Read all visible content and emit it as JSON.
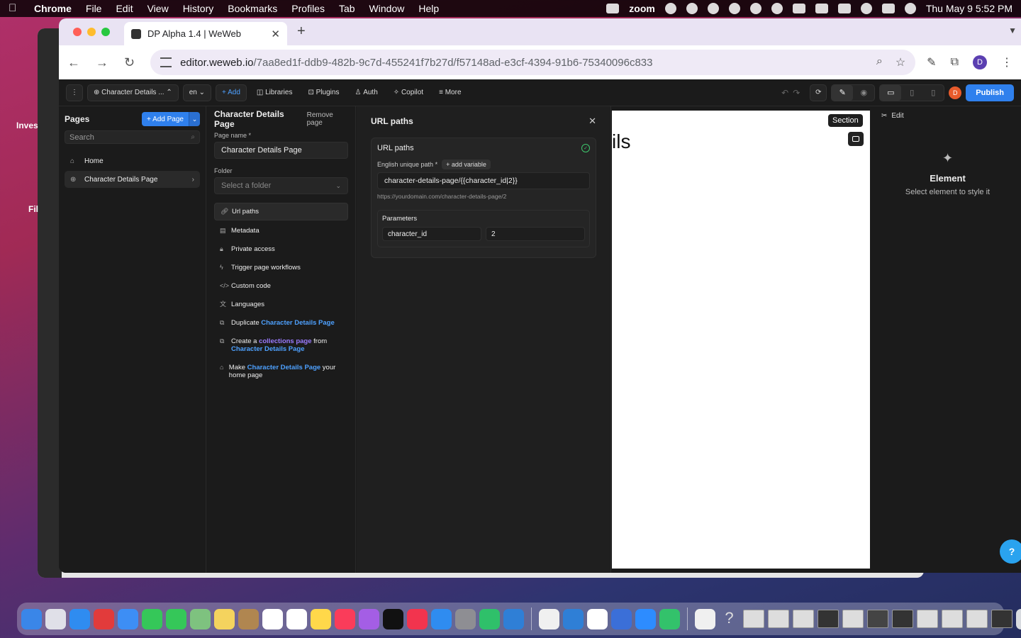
{
  "menubar": {
    "app": "Chrome",
    "items": [
      "File",
      "Edit",
      "View",
      "History",
      "Bookmarks",
      "Profiles",
      "Tab",
      "Window",
      "Help"
    ],
    "zoom_label": "zoom",
    "clock": "Thu May 9  5:52 PM"
  },
  "background": {
    "left_text_1": "Inves",
    "left_text_2": "Fil"
  },
  "browser": {
    "tab_title": "DP Alpha 1.4 | WeWeb",
    "url_host": "editor.weweb.io",
    "url_path": "/7aa8ed1f-ddb9-482b-9c7d-455241f7b27d/f57148ad-e3cf-4394-91b6-75340096c833",
    "profile_initial": "D"
  },
  "editor_top": {
    "page_selector": "Character Details ...",
    "lang": "en",
    "add": "+ Add",
    "libraries": "Libraries",
    "plugins": "Plugins",
    "auth": "Auth",
    "copilot": "Copilot",
    "more": "More",
    "user_initial": "D",
    "publish": "Publish"
  },
  "pages_panel": {
    "title": "Pages",
    "add_page": "+ Add Page",
    "search_placeholder": "Search",
    "items": [
      {
        "label": "Home"
      },
      {
        "label": "Character Details Page"
      }
    ]
  },
  "page_settings": {
    "title": "Character Details Page",
    "remove": "Remove page",
    "page_name_label": "Page name *",
    "page_name_value": "Character Details Page",
    "folder_label": "Folder",
    "folder_placeholder": "Select a folder",
    "menu": {
      "url_paths": "Url paths",
      "metadata": "Metadata",
      "private_access": "Private access",
      "trigger_workflows": "Trigger page workflows",
      "custom_code": "Custom code",
      "languages": "Languages",
      "duplicate_prefix": "Duplicate",
      "duplicate_page": "Character Details Page",
      "create_prefix": "Create a",
      "create_collections": "collections page",
      "create_from": "from",
      "create_page": "Character Details Page",
      "make_prefix": "Make",
      "make_page": "Character Details Page",
      "make_suffix": "your home page"
    }
  },
  "url_panel": {
    "title": "URL paths",
    "card_title": "URL paths",
    "path_label": "English unique path *",
    "add_variable": "+ add variable",
    "path_value": "character-details-page/{{character_id|2}}",
    "hint": "https://yourdomain.com/character-details-page/2",
    "params_title": "Parameters",
    "param_name": "character_id",
    "param_value": "2"
  },
  "canvas": {
    "partial_text": "ils",
    "section_badge": "Section"
  },
  "right_panel": {
    "edit": "Edit",
    "element_title": "Element",
    "element_sub": "Select element to style it"
  },
  "colors": {
    "accent": "#2f80ed",
    "success": "#3ec96d",
    "link": "#4ea1ff",
    "purple": "#9b7bff"
  }
}
